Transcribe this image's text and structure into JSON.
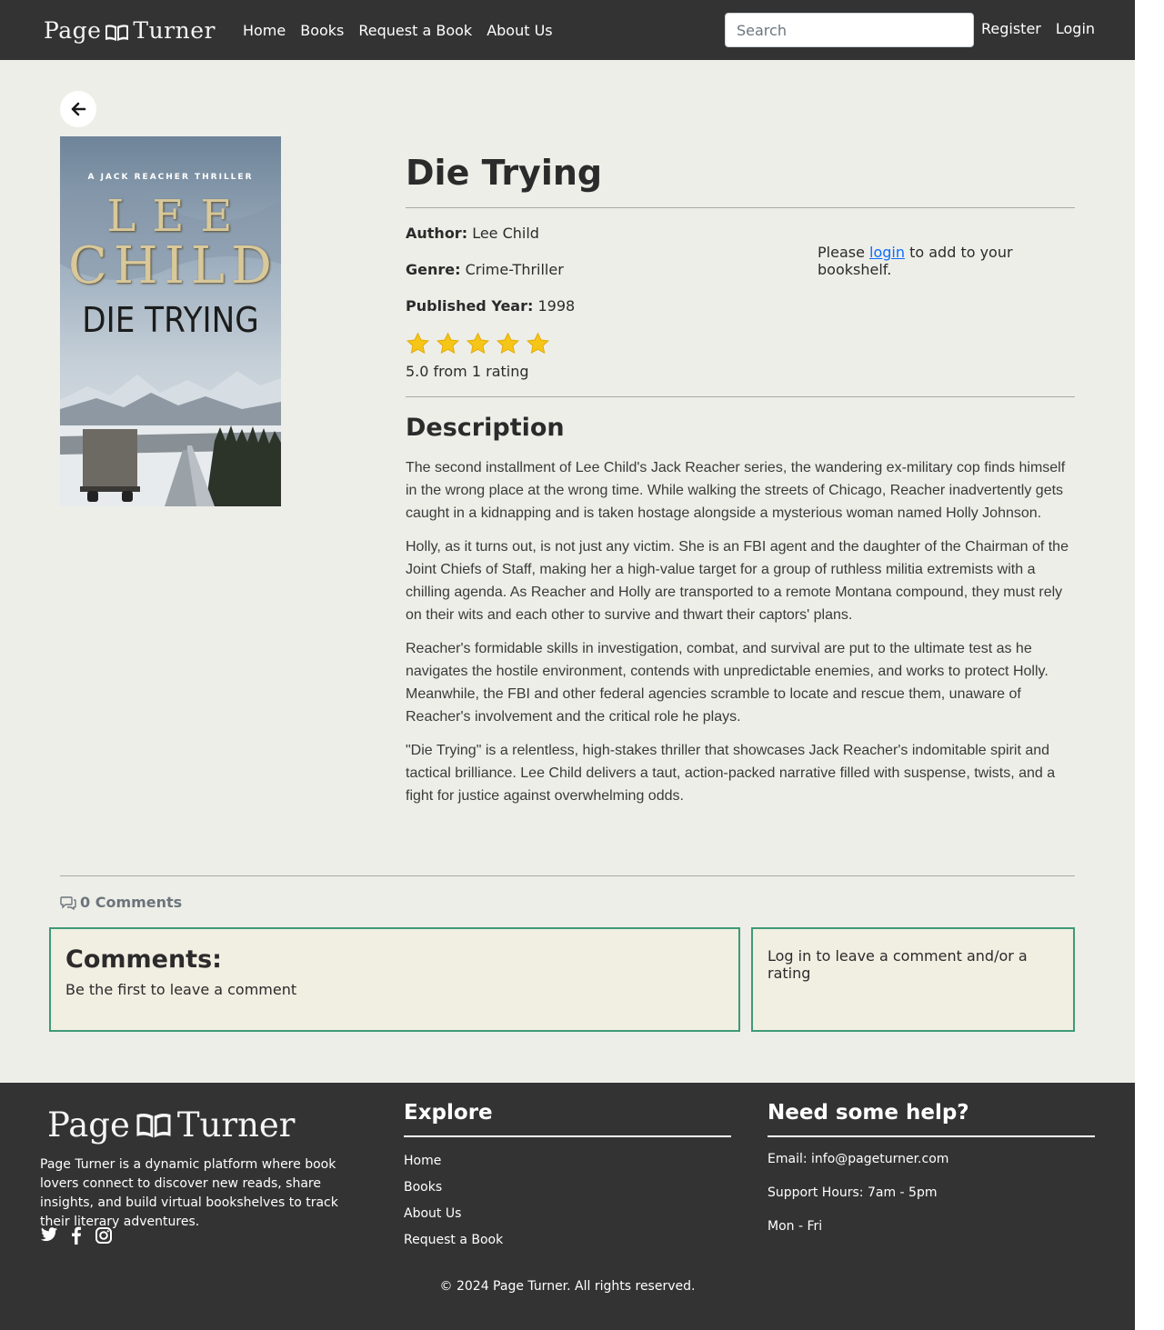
{
  "nav": {
    "logo_text_left": "Page",
    "logo_text_right": "Turner",
    "links": [
      "Home",
      "Books",
      "Request a Book",
      "About Us"
    ],
    "search_placeholder": "Search",
    "register": "Register",
    "login": "Login"
  },
  "cover": {
    "series": "A JACK REACHER THRILLER",
    "author_line1": "LEE",
    "author_line2": "CHILD",
    "title": "DIE TRYING"
  },
  "book": {
    "title": "Die Trying",
    "author_label": "Author:",
    "author": "Lee Child",
    "genre_label": "Genre:",
    "genre": "Crime-Thriller",
    "year_label": "Published Year:",
    "year": "1998",
    "rating_value": 5,
    "rating_max": 5,
    "rating_text": "5.0 from 1 rating",
    "login_prefix": "Please ",
    "login_link": "login",
    "login_suffix": " to add to your bookshelf.",
    "description_heading": "Description",
    "description": [
      "The second installment of Lee Child's Jack Reacher series, the wandering ex-military cop finds himself in the wrong place at the wrong time. While walking the streets of Chicago, Reacher inadvertently gets caught in a kidnapping and is taken hostage alongside a mysterious woman named Holly Johnson.",
      "Holly, as it turns out, is not just any victim. She is an FBI agent and the daughter of the Chairman of the Joint Chiefs of Staff, making her a high-value target for a group of ruthless militia extremists with a chilling agenda. As Reacher and Holly are transported to a remote Montana compound, they must rely on their wits and each other to survive and thwart their captors' plans.",
      "Reacher's formidable skills in investigation, combat, and survival are put to the ultimate test as he navigates the hostile environment, contends with unpredictable enemies, and works to protect Holly. Meanwhile, the FBI and other federal agencies scramble to locate and rescue them, unaware of Reacher's involvement and the critical role he plays.",
      "\"Die Trying\" is a relentless, high-stakes thriller that showcases Jack Reacher's indomitable spirit and tactical brilliance. Lee Child delivers a taut, action-packed narrative filled with suspense, twists, and a fight for justice against overwhelming odds."
    ]
  },
  "comments": {
    "count_label": "0 Comments",
    "heading": "Comments:",
    "empty_text": "Be the first to leave a comment",
    "login_prompt": "Log in to leave a comment and/or a rating"
  },
  "footer": {
    "about": "Page Turner is a dynamic platform where book lovers connect to discover new reads, share insights, and build virtual bookshelves to track their literary adventures.",
    "social_icons": [
      "twitter-icon",
      "facebook-icon",
      "instagram-icon"
    ],
    "explore_heading": "Explore",
    "explore_links": [
      "Home",
      "Books",
      "About Us",
      "Request a Book"
    ],
    "help_heading": "Need some help?",
    "help_lines": [
      "Email: info@pageturner.com",
      "Support Hours: 7am - 5pm",
      "Mon - Fri"
    ],
    "copyright": "© 2024 Page Turner. All rights reserved."
  },
  "colors": {
    "navbar_bg": "#333333",
    "page_bg": "#eeeee8",
    "star": "#f5c518",
    "comment_border": "#3d9a77",
    "comment_bg": "#f1eee2",
    "link": "#0d6efd"
  }
}
